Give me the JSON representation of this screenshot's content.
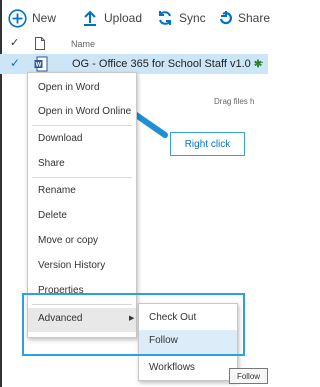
{
  "toolbar": {
    "new_label": "New",
    "upload_label": "Upload",
    "sync_label": "Sync",
    "share_label": "Share"
  },
  "list_header": {
    "check": "✓",
    "name_label": "Name"
  },
  "selected_row": {
    "check": "✓",
    "file_name": "OG - Office 365 for School Staff v1.0",
    "new_marker": "✱",
    "more": "···"
  },
  "drag_hint": "Drag files h",
  "context_menu": {
    "items": [
      "Open in Word",
      "Open in Word Online",
      "Download",
      "Share",
      "Rename",
      "Delete",
      "Move or copy",
      "Version History",
      "Properties",
      "Advanced"
    ],
    "submenu_arrow": "▶"
  },
  "submenu": {
    "items": [
      "Check Out",
      "Follow",
      "Workflows"
    ]
  },
  "callout_label": "Right click",
  "tooltip": "Follow",
  "colors": {
    "accent": "#0072c6",
    "selection": "#cde6f7",
    "highlight_outline": "#2aa2e0"
  }
}
